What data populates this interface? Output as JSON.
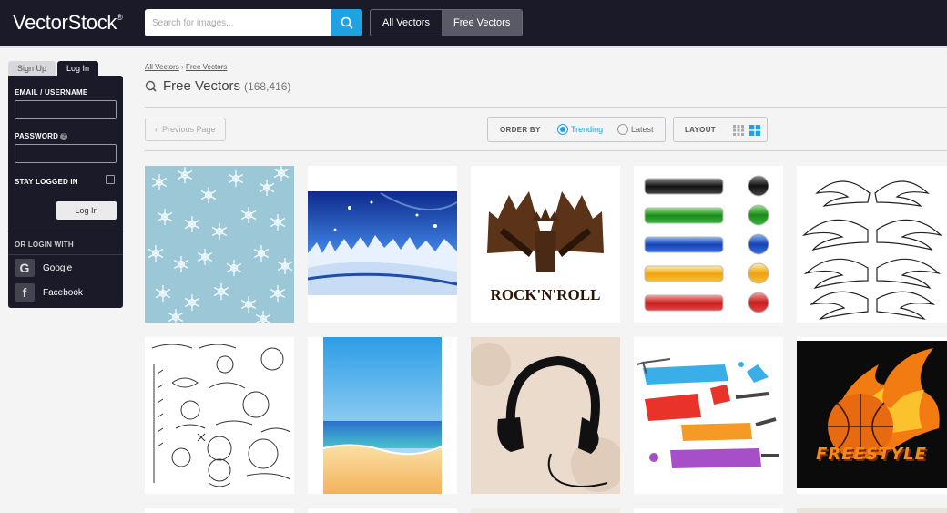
{
  "header": {
    "logo": "VectorStock",
    "logo_mark": "®",
    "search_placeholder": "Search for images...",
    "toggle": [
      {
        "label": "All Vectors",
        "active": false
      },
      {
        "label": "Free Vectors",
        "active": true
      }
    ]
  },
  "login": {
    "tab_signup": "Sign Up",
    "tab_login": "Log In",
    "email_label": "EMAIL / USERNAME",
    "password_label": "PASSWORD",
    "stay_label": "STAY LOGGED IN",
    "login_button": "Log In",
    "or_login": "OR LOGIN WITH",
    "google": "Google",
    "facebook": "Facebook"
  },
  "breadcrumb": {
    "item1": "All Vectors",
    "sep": "›",
    "item2": "Free Vectors"
  },
  "title": {
    "text": "Free Vectors",
    "count": "(168,416)"
  },
  "controls": {
    "prev_page": "Previous Page",
    "order_by": "ORDER BY",
    "trending": "Trending",
    "latest": "Latest",
    "layout": "LAYOUT"
  },
  "tiles": {
    "rock_text": "ROCK'N'ROLL",
    "graffiti_text": "FREESTYLE"
  },
  "colors": {
    "header_bg": "#1a1a28",
    "accent": "#1ea2e2"
  }
}
